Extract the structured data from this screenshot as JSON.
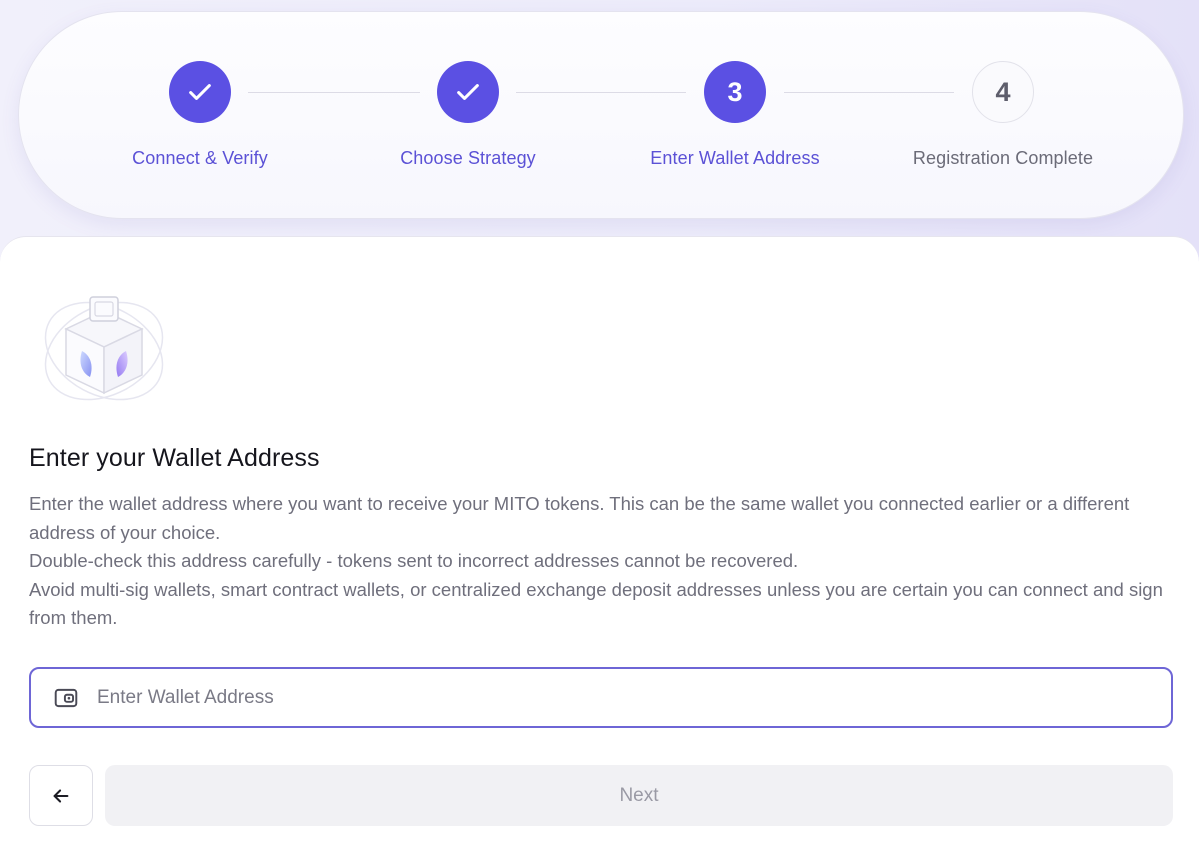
{
  "stepper": {
    "steps": [
      {
        "label": "Connect & Verify",
        "state": "done",
        "indicator": "check-icon"
      },
      {
        "label": "Choose Strategy",
        "state": "done",
        "indicator": "check-icon"
      },
      {
        "label": "Enter Wallet Address",
        "state": "active",
        "number": "3"
      },
      {
        "label": "Registration Complete",
        "state": "pending",
        "number": "4"
      }
    ]
  },
  "main": {
    "illustration_icon": "wallet-cube-illustration",
    "heading": "Enter your Wallet Address",
    "description": [
      "Enter the wallet address where you want to receive your MITO tokens. This can be the same wallet you connected earlier or a different address of your choice.",
      "Double-check this address carefully - tokens sent to incorrect addresses cannot be recovered.",
      "Avoid multi-sig wallets, smart contract wallets, or centralized exchange deposit addresses unless you are certain you can connect and sign from them."
    ],
    "wallet_input": {
      "icon": "wallet-icon",
      "value": "",
      "placeholder": "Enter Wallet Address"
    },
    "back_button": {
      "icon": "arrow-left-icon"
    },
    "next_button": {
      "label": "Next",
      "enabled": false
    }
  },
  "colors": {
    "accent": "#5b50e3",
    "accent_text": "#5b51d6",
    "pending_text": "#6b6b78",
    "input_border": "#6e66d6",
    "disabled_button_bg": "#f1f1f4"
  }
}
